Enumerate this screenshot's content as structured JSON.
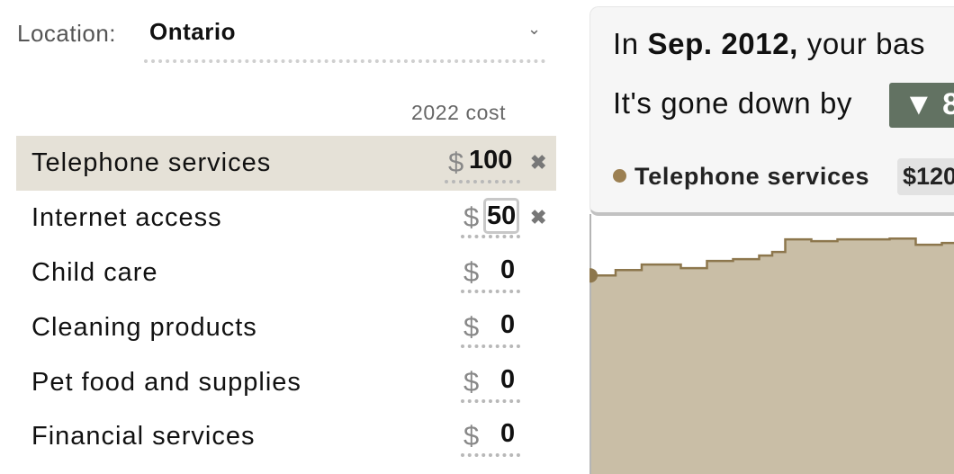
{
  "location": {
    "label": "Location:",
    "value": "Ontario",
    "caret": "⌄"
  },
  "column_header": "2022 cost",
  "currency_symbol": "$",
  "remove_symbol": "✖",
  "items": [
    {
      "label": "Telephone services",
      "amount": "100",
      "highlighted": true,
      "removable": true
    },
    {
      "label": "Internet access",
      "amount": "50",
      "highlighted": false,
      "removable": true,
      "focused": true
    },
    {
      "label": "Child care",
      "amount": "0",
      "highlighted": false,
      "removable": false
    },
    {
      "label": "Cleaning products",
      "amount": "0",
      "highlighted": false,
      "removable": false
    },
    {
      "label": "Pet food and supplies",
      "amount": "0",
      "highlighted": false,
      "removable": false
    },
    {
      "label": "Financial services",
      "amount": "0",
      "highlighted": false,
      "removable": false
    }
  ],
  "summary": {
    "line1_prefix": "In ",
    "line1_date": "Sep. 2012,",
    "line1_suffix": " your bas",
    "line2": "It's gone down by",
    "change": "▼ 8"
  },
  "legend": {
    "name": "Telephone services",
    "value": "$120"
  },
  "colors": {
    "highlight": "#e5e1d7",
    "area_fill": "#c9bea6",
    "line": "#8d774d",
    "badge": "#627262"
  },
  "chart_data": {
    "type": "area",
    "series": [
      {
        "name": "Telephone services",
        "values": [
          120,
          120,
          121.5,
          121.5,
          123,
          123,
          123,
          122,
          122,
          124,
          124,
          124.5,
          124.5,
          125.5,
          126.5,
          130,
          130,
          129.5,
          129.5,
          130,
          130,
          130,
          130,
          130.2,
          130.2,
          128.5,
          128.5,
          129
        ]
      }
    ],
    "ylim": [
      100,
      135
    ]
  }
}
